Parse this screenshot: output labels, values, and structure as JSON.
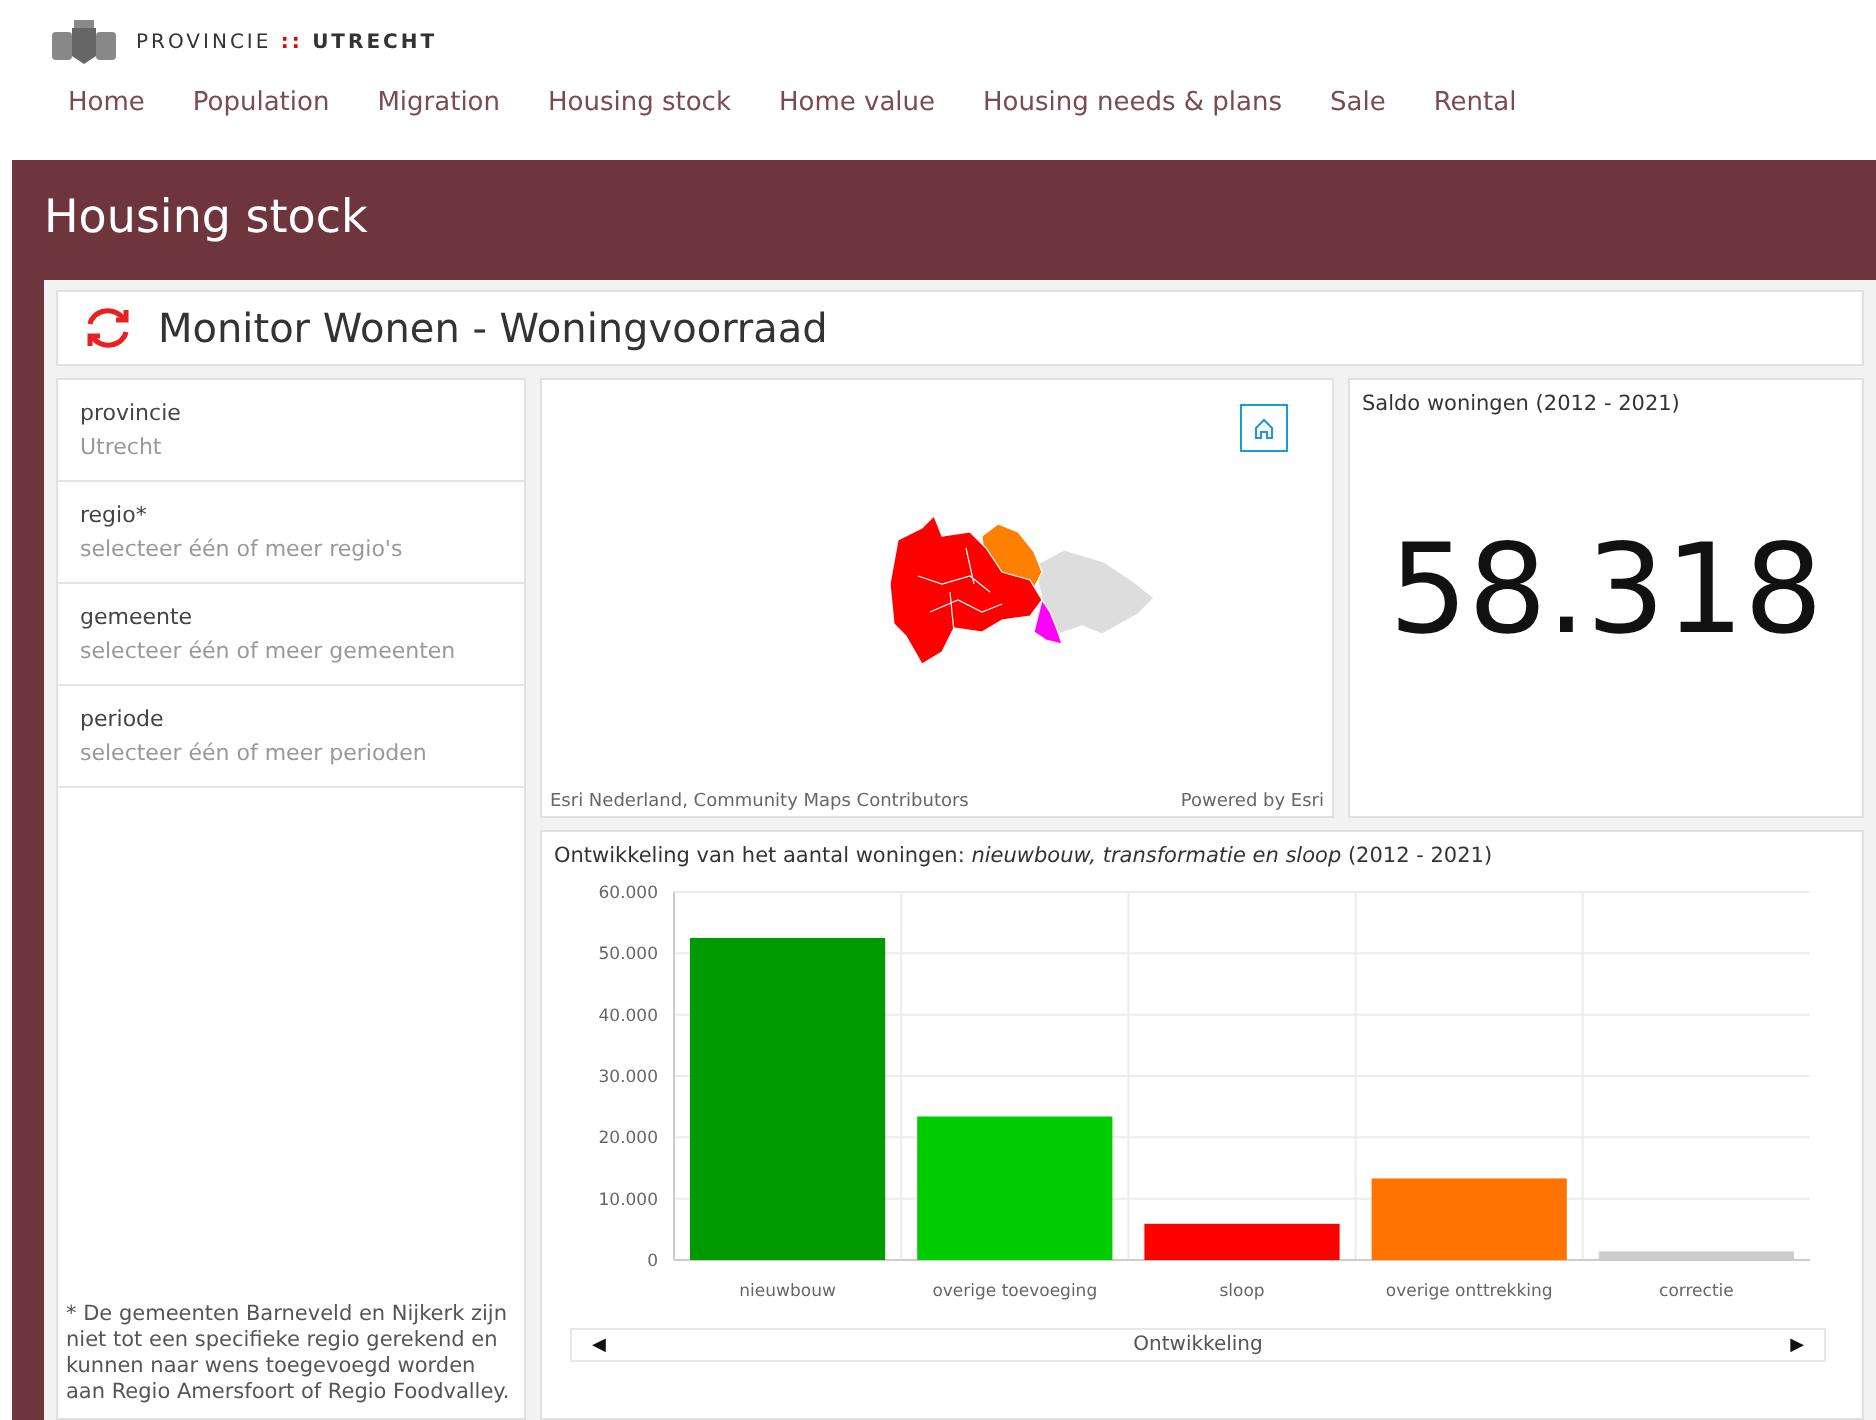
{
  "brand": {
    "name_left": "PROVINCIE",
    "separator": "::",
    "name_right": "UTRECHT"
  },
  "nav": [
    "Home",
    "Population",
    "Migration",
    "Housing stock",
    "Home value",
    "Housing needs & plans",
    "Sale",
    "Rental"
  ],
  "page_title": "Housing stock",
  "dashboard_title": "Monitor Wonen - Woningvoorraad",
  "filters": [
    {
      "label": "provincie",
      "value": "Utrecht"
    },
    {
      "label": "regio*",
      "value": "selecteer één of meer regio's"
    },
    {
      "label": "gemeente",
      "value": "selecteer één of meer gemeenten"
    },
    {
      "label": "periode",
      "value": "selecteer één of meer perioden"
    }
  ],
  "footnote": "* De gemeenten Barneveld en Nijkerk zijn niet tot een specifieke regio gerekend en kunnen naar wens toegevoegd worden aan Regio Amersfoort of Regio Foodvalley.",
  "map": {
    "attribution": "Esri Nederland, Community Maps Contributors",
    "powered_by": "Powered by Esri"
  },
  "indicator": {
    "title": "Saldo woningen (2012 - 2021)",
    "value": "58.318"
  },
  "chart": {
    "title": "Ontwikkeling van het aantal woningen: *nieuwbouw, transformatie en sloop* (2012 - 2021)",
    "chart_data": {
      "type": "bar",
      "xlabel": "Ontwikkeling",
      "categories": [
        "nieuwbouw",
        "overige toevoeging",
        "sloop",
        "overige onttrekking",
        "correctie"
      ],
      "values": [
        52500,
        23400,
        5900,
        13300,
        1400
      ],
      "colors": [
        "#009900",
        "#00cc00",
        "#ff0000",
        "#ff7300",
        "#cccccc"
      ],
      "ylim": [
        0,
        60000
      ],
      "grid": true,
      "yticks": [
        {
          "value": 0,
          "label": "0"
        },
        {
          "value": 10000,
          "label": "10.000"
        },
        {
          "value": 20000,
          "label": "20.000"
        },
        {
          "value": 30000,
          "label": "30.000"
        },
        {
          "value": 40000,
          "label": "40.000"
        },
        {
          "value": 50000,
          "label": "50.000"
        },
        {
          "value": 60000,
          "label": "60.000"
        }
      ]
    },
    "scroll_left": "◀",
    "scroll_right": "▶"
  }
}
